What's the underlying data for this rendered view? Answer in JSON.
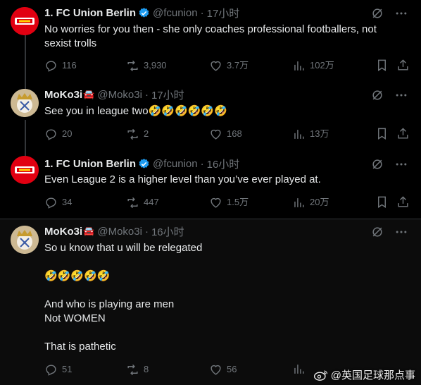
{
  "tweets": [
    {
      "name": "1. FC Union Berlin",
      "handle": "@fcunion",
      "time": "17小时",
      "verified": true,
      "badge": "",
      "lines": [
        "No worries for you then - she only coaches professional footballers, not",
        "sexist trolls"
      ],
      "replies": "116",
      "retweets": "3,930",
      "likes": "3.7万",
      "views": "102万"
    },
    {
      "name": "MoKo3i",
      "handle": "@Moko3i",
      "time": "17小时",
      "verified": false,
      "badge": "🚘",
      "lines": [
        "See you in  league two🤣🤣🤣🤣🤣🤣"
      ],
      "replies": "20",
      "retweets": "2",
      "likes": "168",
      "views": "13万"
    },
    {
      "name": "1. FC Union Berlin",
      "handle": "@fcunion",
      "time": "16小时",
      "verified": true,
      "badge": "",
      "lines": [
        "Even League 2 is a higher level than you’ve ever played at."
      ],
      "replies": "34",
      "retweets": "447",
      "likes": "1.5万",
      "views": "20万"
    },
    {
      "name": "MoKo3i",
      "handle": "@Moko3i",
      "time": "16小时",
      "verified": false,
      "badge": "🚘",
      "lines": [
        "So u know that u will be relegated",
        "",
        "🤣🤣🤣🤣🤣",
        "",
        "And who is playing are men",
        "Not WOMEN",
        "",
        "That is pathetic"
      ],
      "replies": "51",
      "retweets": "8",
      "likes": "56",
      "views": ""
    }
  ],
  "separator": "·",
  "watermark": "@英国足球那点事",
  "icons": [
    "grok-icon",
    "more-icon",
    "reply-icon",
    "retweet-icon",
    "like-icon",
    "views-icon",
    "bookmark-icon",
    "share-icon",
    "weibo-icon"
  ],
  "colors": {
    "background": "#000000",
    "text": "#e7e9ea",
    "secondary": "#71767b",
    "verified": "#1d9bf0",
    "union_red": "#e10011"
  }
}
